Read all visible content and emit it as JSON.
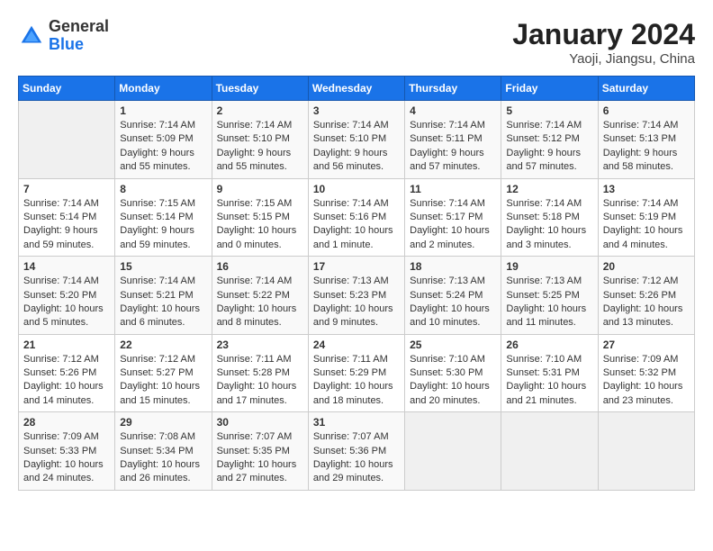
{
  "header": {
    "logo_general": "General",
    "logo_blue": "Blue",
    "month_year": "January 2024",
    "location": "Yaoji, Jiangsu, China"
  },
  "days_of_week": [
    "Sunday",
    "Monday",
    "Tuesday",
    "Wednesday",
    "Thursday",
    "Friday",
    "Saturday"
  ],
  "weeks": [
    [
      {
        "day": "",
        "info": ""
      },
      {
        "day": "1",
        "info": "Sunrise: 7:14 AM\nSunset: 5:09 PM\nDaylight: 9 hours\nand 55 minutes."
      },
      {
        "day": "2",
        "info": "Sunrise: 7:14 AM\nSunset: 5:10 PM\nDaylight: 9 hours\nand 55 minutes."
      },
      {
        "day": "3",
        "info": "Sunrise: 7:14 AM\nSunset: 5:10 PM\nDaylight: 9 hours\nand 56 minutes."
      },
      {
        "day": "4",
        "info": "Sunrise: 7:14 AM\nSunset: 5:11 PM\nDaylight: 9 hours\nand 57 minutes."
      },
      {
        "day": "5",
        "info": "Sunrise: 7:14 AM\nSunset: 5:12 PM\nDaylight: 9 hours\nand 57 minutes."
      },
      {
        "day": "6",
        "info": "Sunrise: 7:14 AM\nSunset: 5:13 PM\nDaylight: 9 hours\nand 58 minutes."
      }
    ],
    [
      {
        "day": "7",
        "info": "Sunrise: 7:14 AM\nSunset: 5:14 PM\nDaylight: 9 hours\nand 59 minutes."
      },
      {
        "day": "8",
        "info": "Sunrise: 7:15 AM\nSunset: 5:14 PM\nDaylight: 9 hours\nand 59 minutes."
      },
      {
        "day": "9",
        "info": "Sunrise: 7:15 AM\nSunset: 5:15 PM\nDaylight: 10 hours\nand 0 minutes."
      },
      {
        "day": "10",
        "info": "Sunrise: 7:14 AM\nSunset: 5:16 PM\nDaylight: 10 hours\nand 1 minute."
      },
      {
        "day": "11",
        "info": "Sunrise: 7:14 AM\nSunset: 5:17 PM\nDaylight: 10 hours\nand 2 minutes."
      },
      {
        "day": "12",
        "info": "Sunrise: 7:14 AM\nSunset: 5:18 PM\nDaylight: 10 hours\nand 3 minutes."
      },
      {
        "day": "13",
        "info": "Sunrise: 7:14 AM\nSunset: 5:19 PM\nDaylight: 10 hours\nand 4 minutes."
      }
    ],
    [
      {
        "day": "14",
        "info": "Sunrise: 7:14 AM\nSunset: 5:20 PM\nDaylight: 10 hours\nand 5 minutes."
      },
      {
        "day": "15",
        "info": "Sunrise: 7:14 AM\nSunset: 5:21 PM\nDaylight: 10 hours\nand 6 minutes."
      },
      {
        "day": "16",
        "info": "Sunrise: 7:14 AM\nSunset: 5:22 PM\nDaylight: 10 hours\nand 8 minutes."
      },
      {
        "day": "17",
        "info": "Sunrise: 7:13 AM\nSunset: 5:23 PM\nDaylight: 10 hours\nand 9 minutes."
      },
      {
        "day": "18",
        "info": "Sunrise: 7:13 AM\nSunset: 5:24 PM\nDaylight: 10 hours\nand 10 minutes."
      },
      {
        "day": "19",
        "info": "Sunrise: 7:13 AM\nSunset: 5:25 PM\nDaylight: 10 hours\nand 11 minutes."
      },
      {
        "day": "20",
        "info": "Sunrise: 7:12 AM\nSunset: 5:26 PM\nDaylight: 10 hours\nand 13 minutes."
      }
    ],
    [
      {
        "day": "21",
        "info": "Sunrise: 7:12 AM\nSunset: 5:26 PM\nDaylight: 10 hours\nand 14 minutes."
      },
      {
        "day": "22",
        "info": "Sunrise: 7:12 AM\nSunset: 5:27 PM\nDaylight: 10 hours\nand 15 minutes."
      },
      {
        "day": "23",
        "info": "Sunrise: 7:11 AM\nSunset: 5:28 PM\nDaylight: 10 hours\nand 17 minutes."
      },
      {
        "day": "24",
        "info": "Sunrise: 7:11 AM\nSunset: 5:29 PM\nDaylight: 10 hours\nand 18 minutes."
      },
      {
        "day": "25",
        "info": "Sunrise: 7:10 AM\nSunset: 5:30 PM\nDaylight: 10 hours\nand 20 minutes."
      },
      {
        "day": "26",
        "info": "Sunrise: 7:10 AM\nSunset: 5:31 PM\nDaylight: 10 hours\nand 21 minutes."
      },
      {
        "day": "27",
        "info": "Sunrise: 7:09 AM\nSunset: 5:32 PM\nDaylight: 10 hours\nand 23 minutes."
      }
    ],
    [
      {
        "day": "28",
        "info": "Sunrise: 7:09 AM\nSunset: 5:33 PM\nDaylight: 10 hours\nand 24 minutes."
      },
      {
        "day": "29",
        "info": "Sunrise: 7:08 AM\nSunset: 5:34 PM\nDaylight: 10 hours\nand 26 minutes."
      },
      {
        "day": "30",
        "info": "Sunrise: 7:07 AM\nSunset: 5:35 PM\nDaylight: 10 hours\nand 27 minutes."
      },
      {
        "day": "31",
        "info": "Sunrise: 7:07 AM\nSunset: 5:36 PM\nDaylight: 10 hours\nand 29 minutes."
      },
      {
        "day": "",
        "info": ""
      },
      {
        "day": "",
        "info": ""
      },
      {
        "day": "",
        "info": ""
      }
    ]
  ]
}
